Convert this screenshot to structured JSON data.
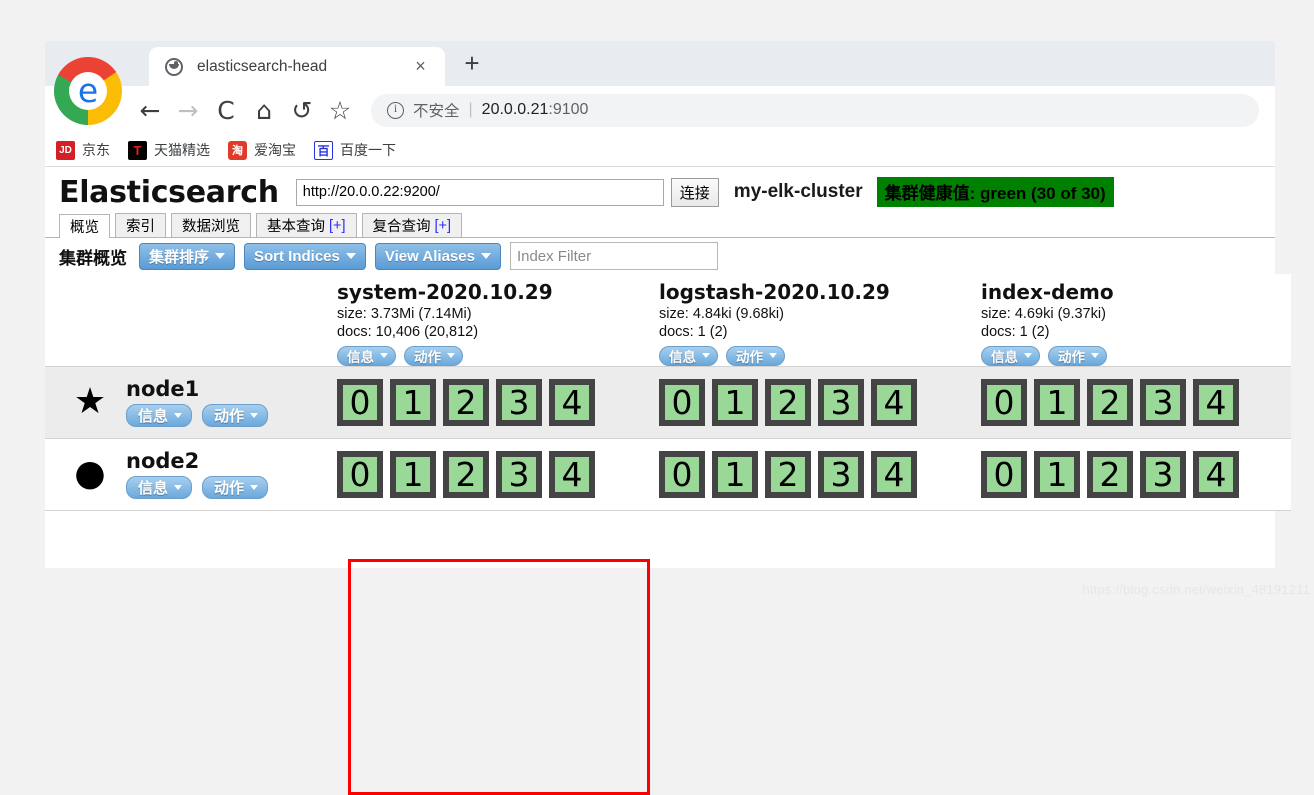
{
  "browser": {
    "tab": {
      "title": "elasticsearch-head",
      "favicon": "globe-icon",
      "close": "×",
      "new_tab": "+"
    },
    "nav": {
      "back": "←",
      "forward": "→",
      "reload": "C",
      "home": "⌂",
      "history": "↺",
      "bookmark": "☆"
    },
    "omnibox": {
      "security_label": "不安全",
      "separator": "|",
      "url_host": "20.0.0.21",
      "url_port": ":9100"
    },
    "bookmarks": [
      {
        "icon_text": "JD",
        "label": "京东"
      },
      {
        "icon_text": "T",
        "label": "天猫精选"
      },
      {
        "icon_text": "淘",
        "label": "爱淘宝"
      },
      {
        "icon_text": "百",
        "label": "百度一下"
      }
    ]
  },
  "app": {
    "brand": "Elasticsearch",
    "url_value": "http://20.0.0.22:9200/",
    "connect_label": "连接",
    "cluster_name": "my-elk-cluster",
    "health_text": "集群健康值: green (30 of 30)",
    "health_color": "#008000",
    "tabs": [
      {
        "label": "概览",
        "suffix": "",
        "active": true
      },
      {
        "label": "索引",
        "suffix": "",
        "active": false
      },
      {
        "label": "数据浏览",
        "suffix": "",
        "active": false
      },
      {
        "label": "基本查询",
        "suffix": "[+]",
        "active": false
      },
      {
        "label": "复合查询",
        "suffix": "[+]",
        "active": false
      }
    ],
    "toolbar": {
      "title": "集群概览",
      "sort_cluster": "集群排序",
      "sort_indices": "Sort Indices",
      "view_aliases": "View Aliases",
      "filter_placeholder": "Index Filter"
    },
    "pill_info": "信息",
    "pill_action": "动作",
    "indices": [
      {
        "name": "system-2020.10.29",
        "size": "size: 3.73Mi (7.14Mi)",
        "docs": "docs: 10,406 (20,812)",
        "shards_node1": [
          "0",
          "1",
          "2",
          "3",
          "4"
        ],
        "shards_node2": [
          "0",
          "1",
          "2",
          "3",
          "4"
        ]
      },
      {
        "name": "logstash-2020.10.29",
        "size": "size: 4.84ki (9.68ki)",
        "docs": "docs: 1 (2)",
        "shards_node1": [
          "0",
          "1",
          "2",
          "3",
          "4"
        ],
        "shards_node2": [
          "0",
          "1",
          "2",
          "3",
          "4"
        ]
      },
      {
        "name": "index-demo",
        "size": "size: 4.69ki (9.37ki)",
        "docs": "docs: 1 (2)",
        "shards_node1": [
          "0",
          "1",
          "2",
          "3",
          "4"
        ],
        "shards_node2": [
          "0",
          "1",
          "2",
          "3",
          "4"
        ]
      }
    ],
    "nodes": [
      {
        "name": "node1",
        "icon": "star-icon",
        "glyph": "★"
      },
      {
        "name": "node2",
        "icon": "circle-icon",
        "glyph": "●"
      }
    ],
    "shard_color": "#9ad898",
    "highlight_color": "#fb0000"
  },
  "watermark": "https://blog.csdn.net/weixin_48191211"
}
